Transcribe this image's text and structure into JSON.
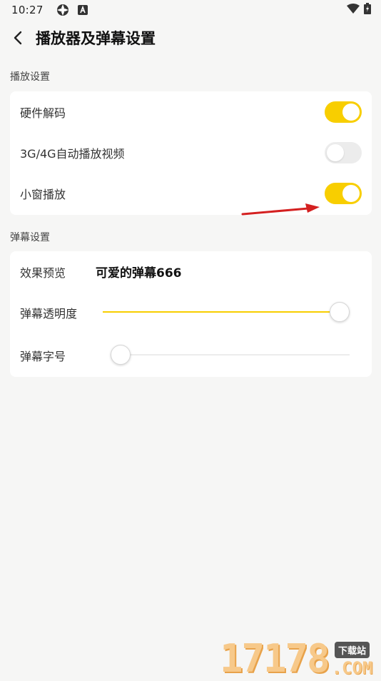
{
  "status_bar": {
    "time": "10:27",
    "icons": [
      "sync-icon",
      "a-notification-icon",
      "wifi-icon",
      "battery-charging-icon"
    ]
  },
  "app_bar": {
    "title": "播放器及弹幕设置",
    "back_icon": "chevron-left-icon"
  },
  "playback_section": {
    "header": "播放设置",
    "items": [
      {
        "label": "硬件解码",
        "enabled": true
      },
      {
        "label": "3G/4G自动播放视频",
        "enabled": false
      },
      {
        "label": "小窗播放",
        "enabled": true
      }
    ]
  },
  "danmaku_section": {
    "header": "弹幕设置",
    "preview": {
      "label": "效果预览",
      "text": "可爱的弹幕666"
    },
    "opacity": {
      "label": "弹幕透明度",
      "value_percent": 100
    },
    "font_size": {
      "label": "弹幕字号",
      "value_percent": 0
    }
  },
  "watermark": {
    "number": "17178",
    "badge": "下载站",
    "suffix": ".COM"
  },
  "colors": {
    "accent": "#f8ce00",
    "background": "#f6f6f5",
    "card": "#ffffff",
    "annotation_arrow": "#d42020"
  }
}
